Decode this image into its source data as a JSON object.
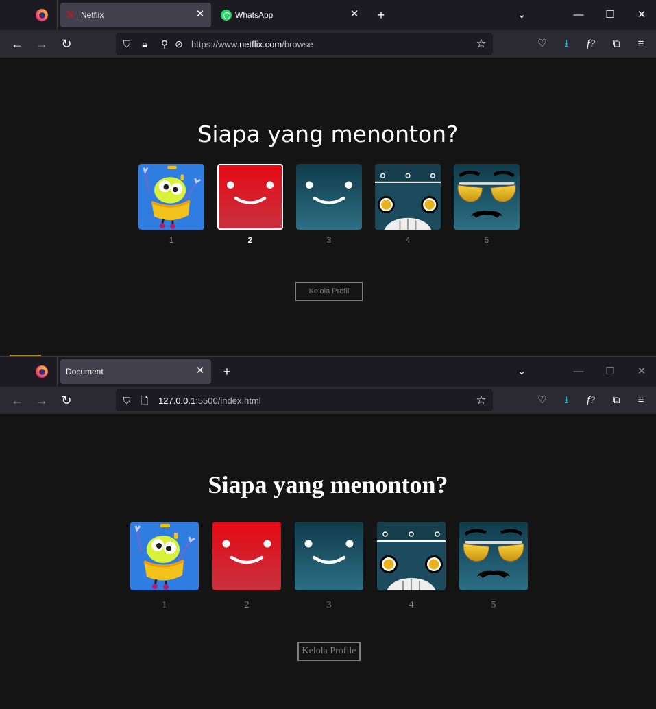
{
  "windows": [
    {
      "tabs": [
        {
          "title": "Netflix",
          "favicon": "netflix-icon",
          "active": true
        },
        {
          "title": "WhatsApp",
          "favicon": "whatsapp-icon",
          "active": false
        }
      ],
      "url": {
        "prefix": "https://www.",
        "host": "netflix.com",
        "path": "/browse"
      },
      "page": {
        "title": "Siapa yang menonton?",
        "profiles": [
          {
            "name": "1",
            "avatar": "kids-character"
          },
          {
            "name": "2",
            "avatar": "red-smile",
            "active": true
          },
          {
            "name": "3",
            "avatar": "teal-smile"
          },
          {
            "name": "4",
            "avatar": "robot-face"
          },
          {
            "name": "5",
            "avatar": "sunglasses-face"
          }
        ],
        "manage_label": "Kelola Profil"
      }
    },
    {
      "tabs": [
        {
          "title": "Document",
          "favicon": "none",
          "active": true
        }
      ],
      "url": {
        "prefix": "",
        "host": "127.0.0.1",
        "path": ":5500/index.html"
      },
      "page": {
        "title": "Siapa yang menonton?",
        "profiles": [
          {
            "name": "1",
            "avatar": "kids-character"
          },
          {
            "name": "2",
            "avatar": "red-smile"
          },
          {
            "name": "3",
            "avatar": "teal-smile"
          },
          {
            "name": "4",
            "avatar": "robot-face"
          },
          {
            "name": "5",
            "avatar": "sunglasses-face"
          }
        ],
        "manage_label": "Kelola Profile"
      }
    }
  ],
  "colors": {
    "netflix_red": "#e50914",
    "teal": "#1f5a70",
    "accent_blue": "#00ddff"
  }
}
